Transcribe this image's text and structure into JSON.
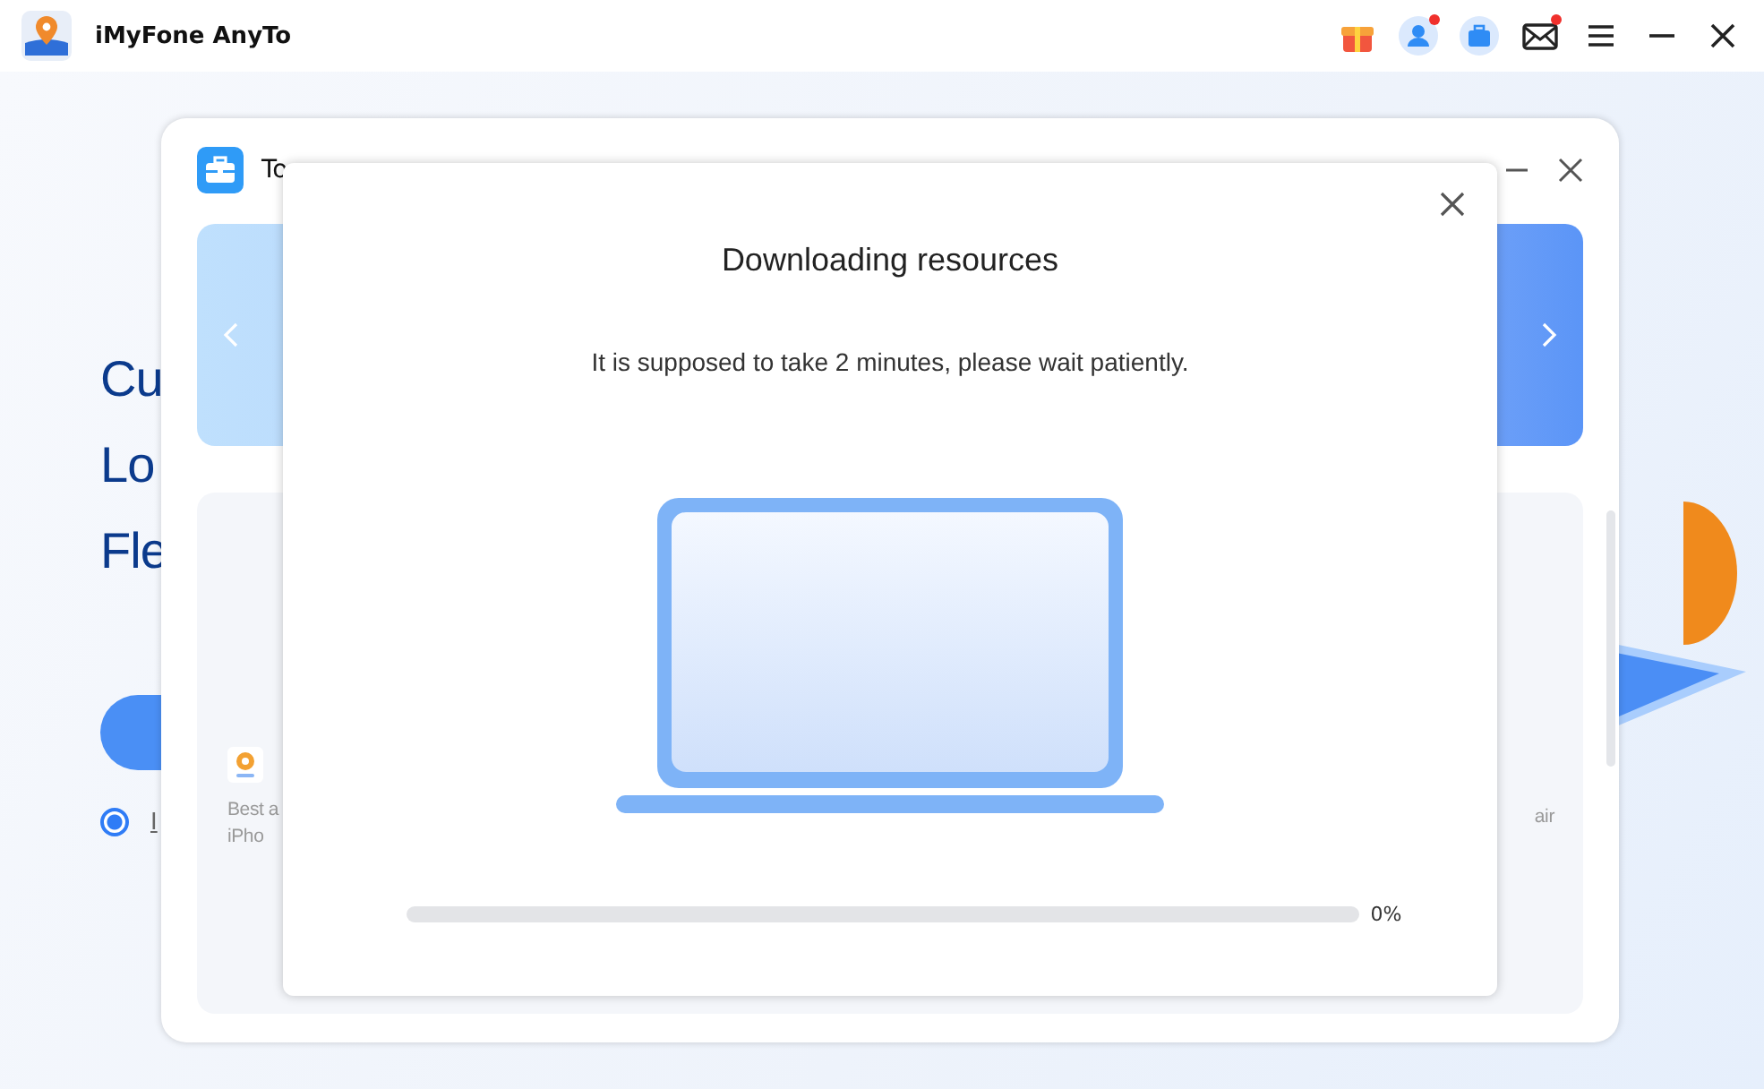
{
  "app": {
    "title": "iMyFone AnyTo"
  },
  "toolbar": [
    {
      "kind": "gift",
      "dot": false
    },
    {
      "kind": "user",
      "dot": true
    },
    {
      "kind": "toolbox",
      "dot": false
    },
    {
      "kind": "mail",
      "dot": true
    },
    {
      "kind": "menu",
      "dot": false
    },
    {
      "kind": "minimize",
      "dot": false
    },
    {
      "kind": "close",
      "dot": false
    }
  ],
  "headline": [
    "Cu",
    "Lo",
    "Fle"
  ],
  "agreement": {
    "checked": true,
    "link": "I"
  },
  "toolbox_window": {
    "title": "To",
    "cards": [
      {
        "lines": [
          "Best a",
          "iPho"
        ]
      },
      {
        "lines": [
          "air"
        ]
      }
    ]
  },
  "dialog": {
    "title": "Downloading resources",
    "message": "It is supposed to take 2 minutes, please wait patiently.",
    "progress": {
      "level": 0,
      "reading": "0%"
    }
  }
}
